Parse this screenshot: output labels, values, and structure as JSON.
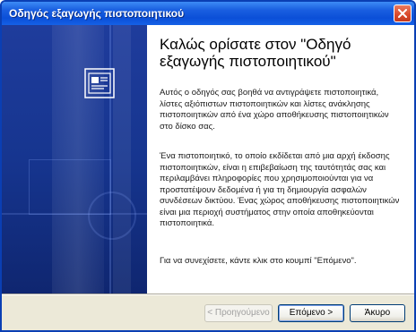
{
  "window": {
    "title": "Οδηγός εξαγωγής πιστοποιητικού",
    "close_icon": "close-icon"
  },
  "sidebar": {
    "icon": "certificate-icon",
    "accent_color": "#16358f"
  },
  "main": {
    "heading": "Καλώς ορίσατε στον \"Οδηγό εξαγωγής πιστοποιητικού\"",
    "paragraph1": "Αυτός ο οδηγός σας βοηθά να αντιγράψετε πιστοποιητικά, λίστες αξιόπιστων πιστοποιητικών και λίστες ανάκλησης πιστοποιητικών από ένα χώρο αποθήκευσης πιστοποιητικών στο δίσκο σας.",
    "paragraph2": "Ένα πιστοποιητικό, το οποίο εκδίδεται από μια αρχή έκδοσης πιστοποιητικών, είναι η επιβεβαίωση της ταυτότητάς σας και περιλαμβάνει πληροφορίες που χρησιμοποιούνται για να προστατέψουν δεδομένα ή για τη δημιουργία ασφαλών συνδέσεων δικτύου. Ένας χώρος αποθήκευσης πιστοποιητικών είναι μια περιοχή συστήματος στην οποία αποθηκεύονται πιστοποιητικά.",
    "paragraph3": "Για να συνεχίσετε, κάντε κλικ στο κουμπί \"Επόμενο\"."
  },
  "buttons": {
    "back_label": "< Προηγούμενο",
    "next_label": "Επόμενο >",
    "cancel_label": "Άκυρο"
  }
}
